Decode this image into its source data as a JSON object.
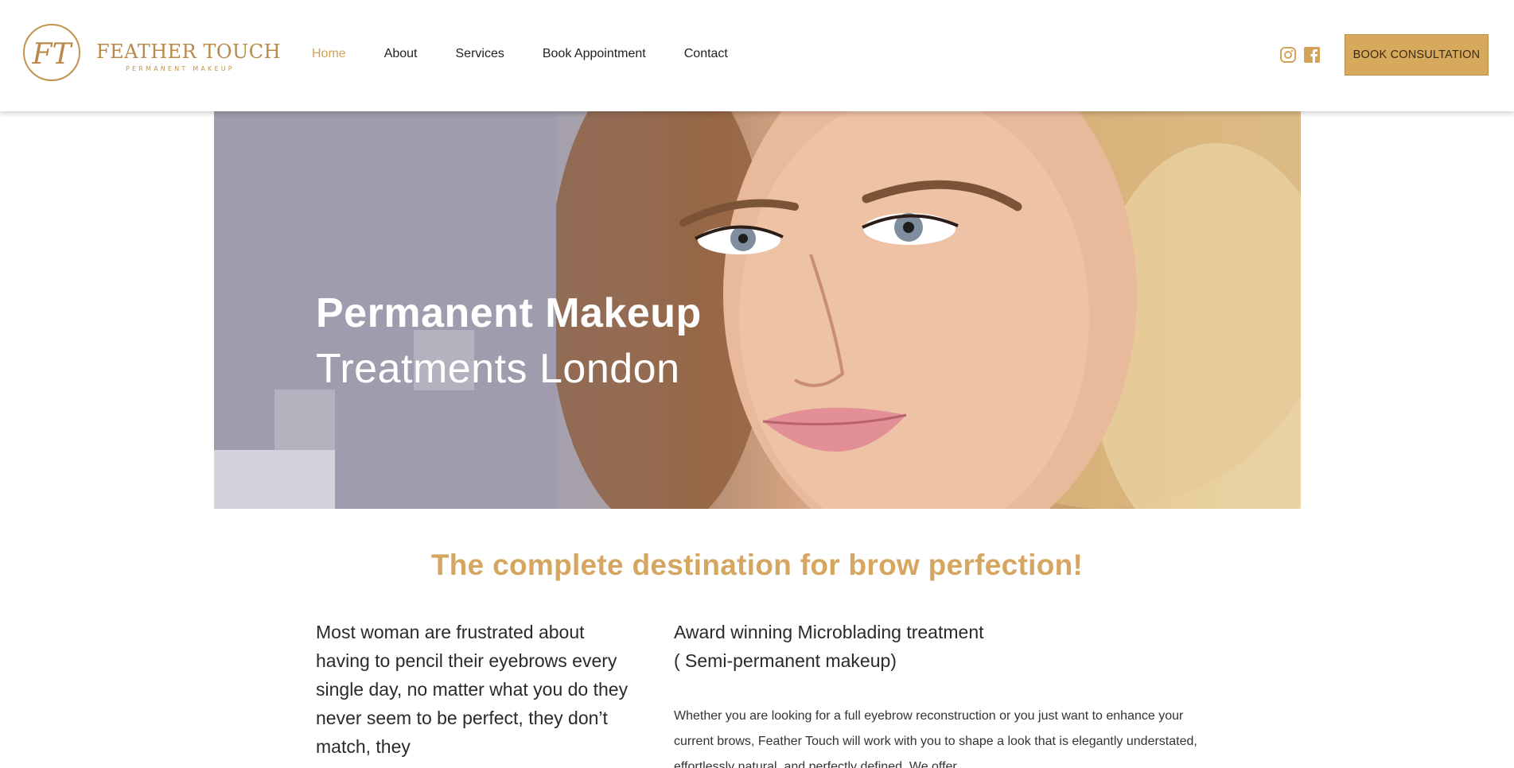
{
  "brand": {
    "monogram": "FT",
    "name": "FEATHER TOUCH",
    "tagline": "PERMANENT MAKEUP",
    "gold": "#d4a25a"
  },
  "nav": {
    "items": [
      {
        "label": "Home",
        "active": true
      },
      {
        "label": "About",
        "active": false
      },
      {
        "label": "Services",
        "active": false
      },
      {
        "label": "Book Appointment",
        "active": false
      },
      {
        "label": "Contact",
        "active": false
      }
    ]
  },
  "social": {
    "icons": [
      "instagram-icon",
      "facebook-icon"
    ]
  },
  "cta": {
    "label": "BOOK CONSULTATION"
  },
  "hero": {
    "title": "Permanent Makeup",
    "subtitle": "Treatments London",
    "image": "hero-portrait-blonde-woman"
  },
  "content": {
    "tagline": "The complete destination for brow perfection!",
    "intro": "Most woman are frustrated about having to pencil their eyebrows every single day, no matter what you do they never seem to be perfect, they don’t match, they",
    "award_line1": "Award winning Microblading treatment",
    "award_line2": "( Semi-permanent makeup)",
    "description": "Whether you are looking for a full eyebrow reconstruction or you just want to enhance your current brows, Feather Touch will work with you to shape a look that is elegantly understated, effortlessly natural, and perfectly defined. We offer"
  }
}
